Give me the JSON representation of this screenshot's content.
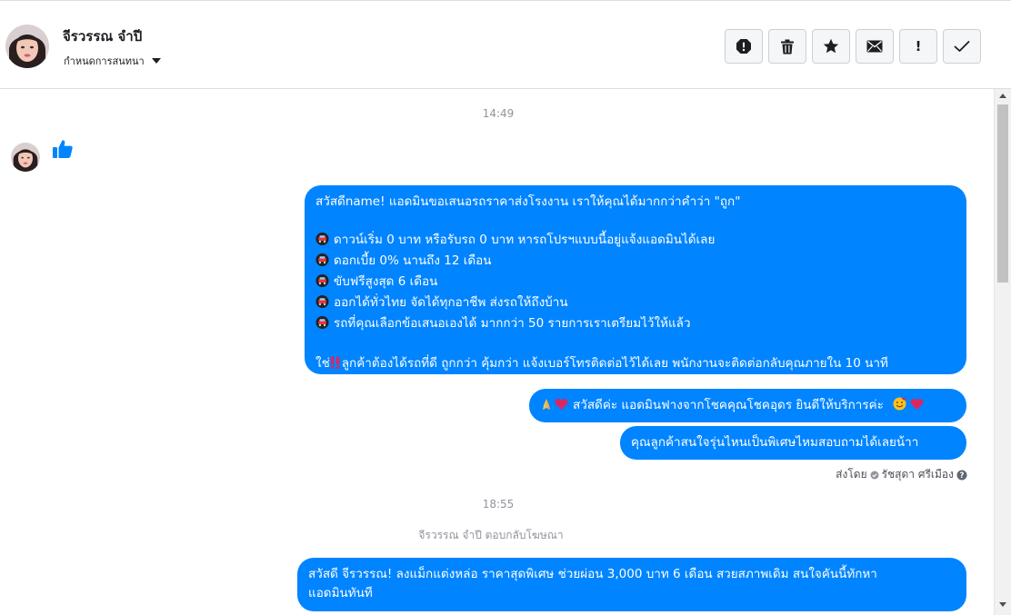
{
  "header": {
    "contact_name": "จีรวรรณ จำปี",
    "label_button": "กำหนดการสนทนา",
    "actions": [
      {
        "name": "spam-icon"
      },
      {
        "name": "trash-icon"
      },
      {
        "name": "star-icon"
      },
      {
        "name": "envelope-icon"
      },
      {
        "name": "important-icon",
        "glyph": "!"
      },
      {
        "name": "check-icon"
      }
    ]
  },
  "thread": {
    "timestamp_1": "14:49",
    "timestamp_2": "18:55",
    "message_1": {
      "intro": "สวัสดีname! แอดมินขอเสนอรถราคาส่งโรงงาน เราให้คุณได้มากกว่าคำว่า \"ถูก\"",
      "bullets": [
        "ดาวน์เริ่ม 0 บาท หรือรับรถ 0 บาท หารถโปรฯแบบนี้อยู่แจ้งแอดมินได้เลย",
        "ดอกเบี้ย 0% นานถึง 12 เดือน",
        "ขับฟรีสูงสุด 6 เดือน",
        "ออกได้ทั่วไทย จัดได้ทุกอาชีพ ส่งรถให้ถึงบ้าน",
        "รถที่คุณเลือกข้อเสนอเองได้ มากกว่า 50 รายการเราเตรียมไว้ให้แล้ว"
      ],
      "closing_prefix": "ใช่",
      "closing_text": "ลูกค้าต้องได้รถที่ดี ถูกกว่า คุ้มกว่า แจ้งเบอร์โทรติดต่อไว้ได้เลย พนักงานจะติดต่อกลับคุณภายใน 10 นาที"
    },
    "message_2": "สวัสดีค่ะ แอดมินฟางจากโชคคุณโชคอุดร ยินดีให้บริการค่ะ",
    "message_3": "คุณลูกค้าสนใจรุ่นไหนเป็นพิเศษไหมสอบถามได้เลยน้าา",
    "sent_by": {
      "prefix": "ส่งโดย",
      "sender": "รัชสุดา ศรีเมือง"
    },
    "reply_note": "จีรวรรณ จำปี ตอบกลับโฆษณา",
    "message_4": {
      "line_1": "สวัสดี จีรวรรณ! ลงแม็กแต่งหล่อ ราคาสุดพิเศษ ช่วยผ่อน 3,000 บาท 6 เดือน สวยสภาพเดิม สนใจคันนี้ทักหา",
      "line_2": "แอดมินทันที"
    }
  },
  "colors": {
    "bubble": "#0084ff",
    "like": "#0084ff",
    "timestamp": "#90949c"
  }
}
